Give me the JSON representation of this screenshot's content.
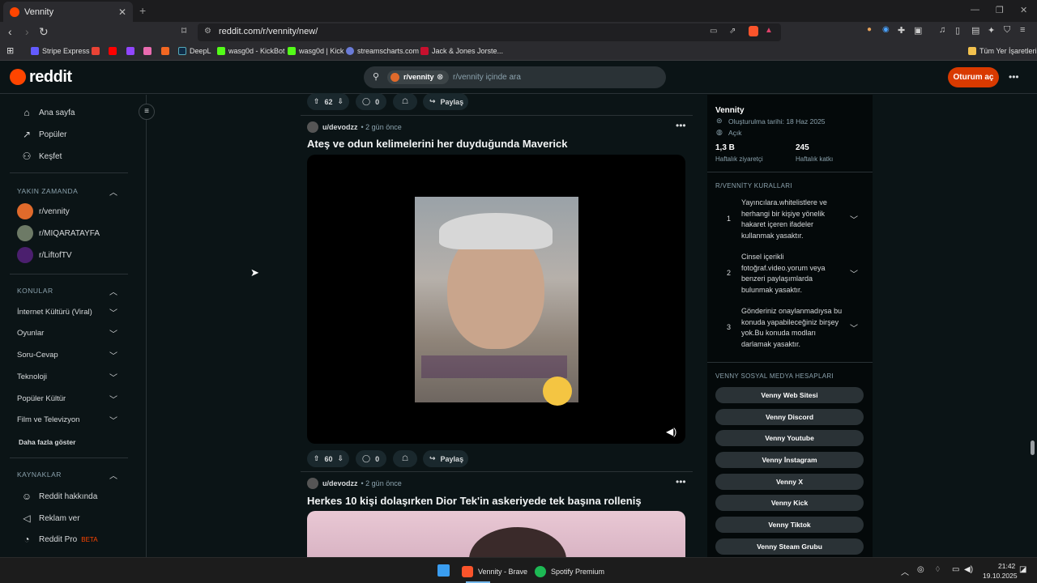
{
  "browser": {
    "tab_title": "Vennity",
    "url": "reddit.com/r/vennity/new/",
    "bookmarks": [
      "Stripe Express",
      "DeepL",
      "wasg0d - KickBot",
      "wasg0d | Kick",
      "streamscharts.com",
      "Jack & Jones Jorste..."
    ],
    "all_bookmarks": "Tüm Yer İşaretleri"
  },
  "header": {
    "logo": "reddit",
    "search_chip": "r/vennity",
    "search_placeholder": "r/vennity içinde ara",
    "login": "Oturum aç"
  },
  "sidebar": {
    "nav": [
      "Ana sayfa",
      "Popüler",
      "Keşfet"
    ],
    "recent_head": "YAKIN ZAMANDA",
    "recent": [
      "r/vennity",
      "r/MIQARATAYFA",
      "r/LiftofTV"
    ],
    "topics_head": "KONULAR",
    "topics": [
      "İnternet Kültürü (Viral)",
      "Oyunlar",
      "Soru-Cevap",
      "Teknoloji",
      "Popüler Kültür",
      "Film ve Televizyon"
    ],
    "more": "Daha fazla göster",
    "resources_head": "KAYNAKLAR",
    "resources": [
      "Reddit hakkında",
      "Reklam ver",
      "Reddit Pro"
    ],
    "beta": "BETA"
  },
  "posts": [
    {
      "votes": "62",
      "comments": "0",
      "share": "Paylaş"
    },
    {
      "author": "u/devodzz",
      "time": "2 gün önce",
      "title": "Ateş ve odun kelimelerini her duyduğunda Maverick",
      "votes": "60",
      "comments": "0",
      "share": "Paylaş"
    },
    {
      "author": "u/devodzz",
      "time": "2 gün önce",
      "title": "Herkes 10 kişi dolaşırken Dior Tek'in askeriyede tek başına rolleniş"
    }
  ],
  "community": {
    "name": "Vennity",
    "created": "Oluşturulma tarihi: 18 Haz 2025",
    "visibility": "Açık",
    "visitors": "1,3 B",
    "visitors_label": "Haftalık ziyaretçi",
    "contrib": "245",
    "contrib_label": "Haftalık katkı",
    "rules_head": "R/VENNİTY KURALLARI",
    "rules": [
      {
        "num": "1",
        "text": "Yayıncılara.whitelistlere ve herhangi bir kişiye yönelik hakaret içeren ifadeler kullanmak yasaktır."
      },
      {
        "num": "2",
        "text": "Cinsel içerikli fotoğraf.video.yorum veya benzeri paylaşımlarda bulunmak yasaktır."
      },
      {
        "num": "3",
        "text": "Gönderiniz onaylanmadıysa bu konuda yapabileceğiniz birşey yok.Bu konuda modları darlamak yasaktır."
      }
    ],
    "social_head": "VENNY SOSYAL MEDYA HESAPLARI",
    "social": [
      "Venny Web Sitesi",
      "Venny Discord",
      "Venny Youtube",
      "Venny İnstagram",
      "Venny X",
      "Venny Kick",
      "Venny Tiktok",
      "Venny Steam Grubu"
    ]
  },
  "taskbar": {
    "apps": [
      "Vennity - Brave",
      "Spotify Premium"
    ],
    "time": "21:42",
    "date": "19.10.2025"
  }
}
